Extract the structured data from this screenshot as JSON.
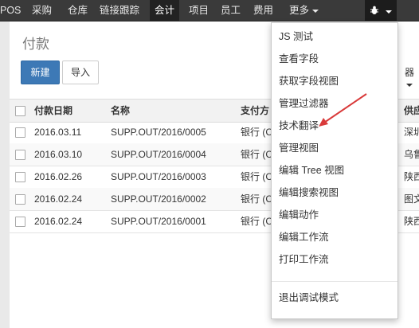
{
  "topnav": {
    "items": [
      "POS",
      "采购",
      "仓库",
      "链接跟踪",
      "会计",
      "项目",
      "员工",
      "费用",
      "更多"
    ],
    "active": "会计",
    "debug_icon": "bug-icon"
  },
  "page": {
    "title": "付款",
    "new_label": "新建",
    "import_label": "导入",
    "filter_partial": "器"
  },
  "table": {
    "headers": [
      "付款日期",
      "名称",
      "支付方",
      "供应商"
    ],
    "header_visible": {
      "date": "付款日期",
      "name": "名称",
      "pay": "支付方",
      "ext": "供应商"
    },
    "rows": [
      {
        "date": "2016.03.11",
        "name": "SUPP.OUT/2016/0005",
        "pay": "银行 (C",
        "ext": "深圳-"
      },
      {
        "date": "2016.03.10",
        "name": "SUPP.OUT/2016/0004",
        "pay": "银行 (C",
        "ext": "乌鲁木"
      },
      {
        "date": "2016.02.26",
        "name": "SUPP.OUT/2016/0003",
        "pay": "银行 (C",
        "ext": "陕西纟"
      },
      {
        "date": "2016.02.24",
        "name": "SUPP.OUT/2016/0002",
        "pay": "银行 (C",
        "ext": "图文情"
      },
      {
        "date": "2016.02.24",
        "name": "SUPP.OUT/2016/0001",
        "pay": "银行 (C",
        "ext": "陕西纟"
      }
    ]
  },
  "debug_menu": {
    "items": [
      "JS 测试",
      "查看字段",
      "获取字段视图",
      "管理过滤器",
      "技术翻译",
      "管理视图",
      "编辑 Tree 视图",
      "编辑搜索视图",
      "编辑动作",
      "编辑工作流",
      "打印工作流"
    ],
    "exit_label": "退出调试模式"
  },
  "colors": {
    "nav_bg": "#3a3a3a",
    "primary_button": "#3d79b6",
    "annotation_arrow": "#d93a3a"
  }
}
